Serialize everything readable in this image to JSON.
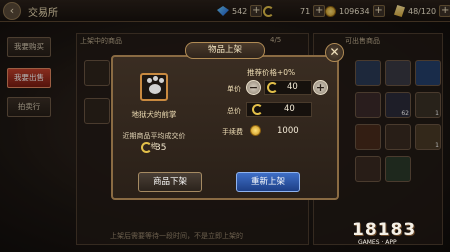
{
  "header": {
    "back_icon": "back-arrow-icon",
    "title": "交易所",
    "gems": "542",
    "coins": "71",
    "gold": "109634",
    "stamina": "48/120",
    "plus": "+"
  },
  "tabs": [
    {
      "label": "我要购买"
    },
    {
      "label": "我要出售"
    },
    {
      "label": "拍卖行"
    }
  ],
  "panels": {
    "listed_header": "上架中的商品",
    "listed_count": "4/5",
    "sell_header": "可出售商品",
    "hint": "上架后需要等待一段时间，不是立即上架的"
  },
  "inventory_counts": [
    "62",
    "1",
    "1"
  ],
  "dialog": {
    "title": "物品上架",
    "close": "✕",
    "item_name": "地狱犬的前掌",
    "avg_price_label": "近期商品平均成交价格",
    "avg_price": "35",
    "recommend": "推荐价格+0%",
    "unit_price_label": "单价",
    "unit_price": "40",
    "total_label": "总价",
    "total": "40",
    "fee_label": "手续费",
    "fee": "1000",
    "minus": "−",
    "plus": "+",
    "unlist_button": "商品下架",
    "relist_button": "重新上架"
  },
  "watermark": {
    "text": "18183",
    "sub": "GAMES · APP"
  },
  "colors": {
    "active_tab": "#c2402c",
    "relist_button": "#3f6fc7",
    "dialog_border": "#8a6b43"
  }
}
